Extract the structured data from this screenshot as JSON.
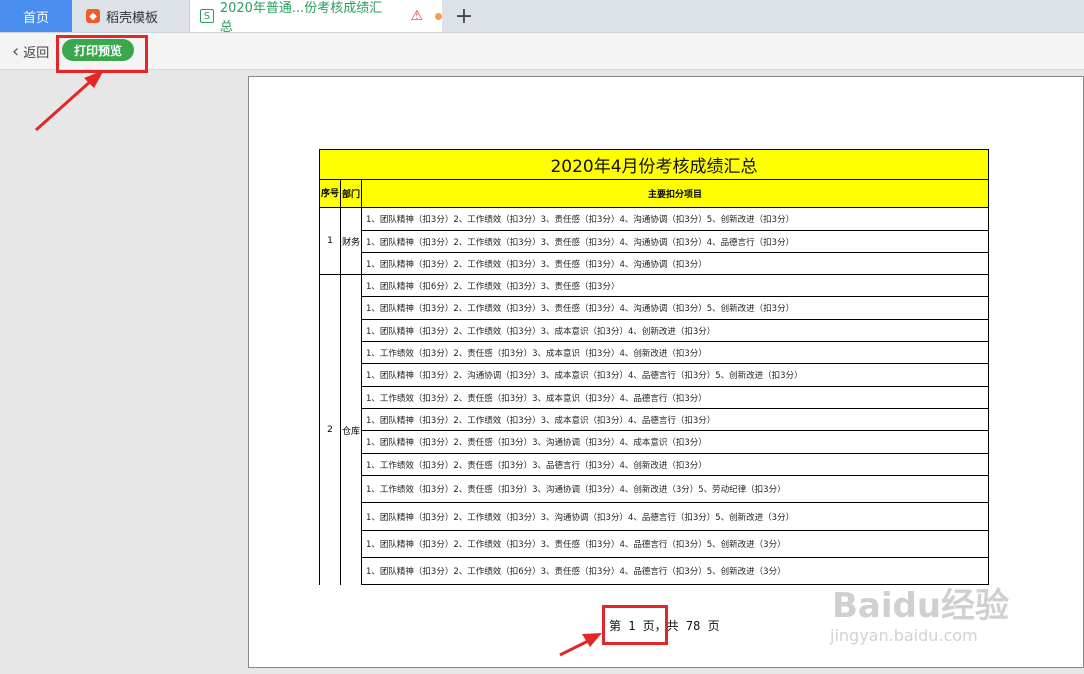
{
  "tabs": {
    "home": "首页",
    "templates": "稻壳模板",
    "doc": "2020年普通...份考核成绩汇总",
    "new_tab": "+"
  },
  "toolbar": {
    "back": "返回",
    "print_preview": "打印预览"
  },
  "sheet": {
    "title": "2020年4月份考核成绩汇总",
    "col_seq": "序号",
    "col_dept": "部门",
    "col_items": "主要扣分项目",
    "groups": [
      {
        "seq": "1",
        "dept": "财务",
        "rows": [
          "1、团队精神（扣3分）2、工作绩效（扣3分）3、责任感（扣3分）4、沟通协调（扣3分）5、创新改进（扣3分）",
          "1、团队精神（扣3分）2、工作绩效（扣3分）3、责任感（扣3分）4、沟通协调（扣3分）4、品德言行（扣3分）",
          "1、团队精神（扣3分）2、工作绩效（扣3分）3、责任感（扣3分）4、沟通协调（扣3分）"
        ]
      },
      {
        "seq": "2",
        "dept": "仓库",
        "rows": [
          "1、团队精神（扣6分）2、工作绩效（扣3分）3、责任感（扣3分）",
          "1、团队精神（扣3分）2、工作绩效（扣3分）3、责任感（扣3分）4、沟通协调（扣3分）5、创新改进（扣3分）",
          "1、团队精神（扣3分）2、工作绩效（扣3分）3、成本意识（扣3分）4、创新改进（扣3分）",
          "1、工作绩效（扣3分）2、责任感（扣3分）3、成本意识（扣3分）4、创新改进（扣3分）",
          "1、团队精神（扣3分）2、沟通协调（扣3分）3、成本意识（扣3分）4、品德言行（扣3分）5、创新改进（扣3分）",
          "1、工作绩效（扣3分）2、责任感（扣3分）3、成本意识（扣3分）4、品德言行（扣3分）",
          "1、团队精神（扣3分）2、工作绩效（扣3分）3、成本意识（扣3分）4、品德言行（扣3分）",
          "1、团队精神（扣3分）2、责任感（扣3分）3、沟通协调（扣3分）4、成本意识（扣3分）",
          "1、工作绩效（扣3分）2、责任感（扣3分）3、品德言行（扣3分）4、创新改进（扣3分）",
          "1、工作绩效（扣3分）2、责任感（扣3分）3、沟通协调（扣3分）4、创新改进（3分）5、劳动纪律（扣3分）",
          "1、团队精神（扣3分）2、工作绩效（扣3分）3、沟通协调（扣3分）4、品德言行（扣3分）5、创新改进（3分）",
          "1、团队精神（扣3分）2、工作绩效（扣3分）3、责任感（扣3分）4、品德言行（扣3分）5、创新改进（3分）",
          "1、团队精神（扣3分）2、工作绩效（扣6分）3、责任感（扣3分）4、品德言行（扣3分）5、创新改进（3分）"
        ]
      }
    ],
    "pager": "第 1 页，共 78 页"
  },
  "watermark": {
    "brand": "Baidu经验",
    "url": "jingyan.baidu.com"
  }
}
